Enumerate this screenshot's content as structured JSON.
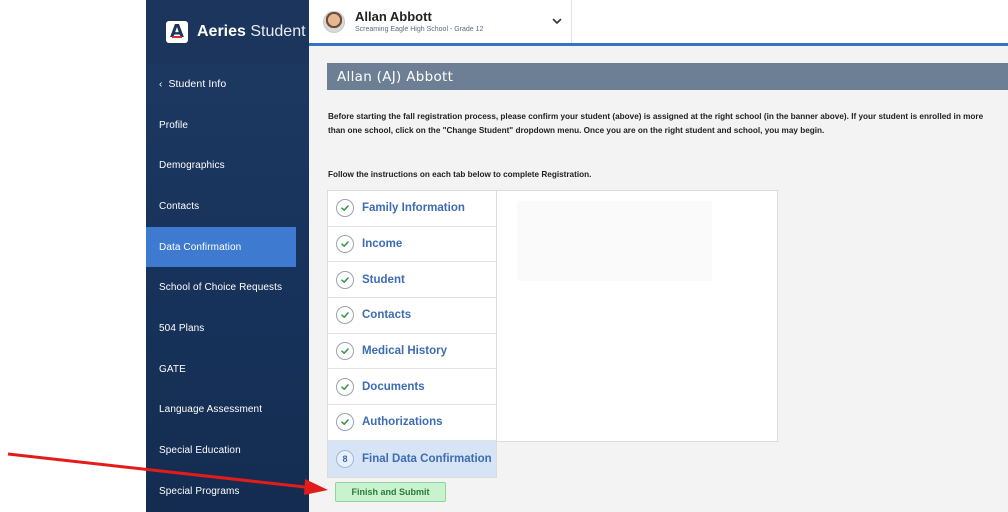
{
  "brand": {
    "bold": "Aeries",
    "light": "Student"
  },
  "student": {
    "name": "Allan Abbott",
    "school": "Screaming Eagle High School - Grade 12"
  },
  "sidebar": {
    "items": [
      {
        "label": "Student Info",
        "back": true
      },
      {
        "label": "Profile"
      },
      {
        "label": "Demographics"
      },
      {
        "label": "Contacts"
      },
      {
        "label": "Data Confirmation",
        "active": true
      },
      {
        "label": "School of Choice Requests"
      },
      {
        "label": "504 Plans"
      },
      {
        "label": "GATE"
      },
      {
        "label": "Language Assessment"
      },
      {
        "label": "Special Education"
      },
      {
        "label": "Special Programs"
      }
    ]
  },
  "main": {
    "title": "Allan (AJ) Abbott",
    "intro": "Before starting the fall registration process, please confirm your student (above) is assigned at the right school (in the banner above). If your student is enrolled in more than one school, click on the \"Change Student\" dropdown menu. Once you are on the right student and school, you may begin.",
    "follow": "Follow the instructions on each tab below to complete Registration.",
    "tabs": [
      {
        "label": "Family Information",
        "done": true
      },
      {
        "label": "Income",
        "done": true
      },
      {
        "label": "Student",
        "done": true
      },
      {
        "label": "Contacts",
        "done": true
      },
      {
        "label": "Medical History",
        "done": true
      },
      {
        "label": "Documents",
        "done": true
      },
      {
        "label": "Authorizations",
        "done": true
      },
      {
        "label": "Final Data Confirmation",
        "done": false,
        "number": "8"
      }
    ],
    "finish_label": "Finish and Submit"
  },
  "colors": {
    "sidebar": "#1b355c",
    "accent": "#3f7ad1",
    "title_bar": "#6c7f95",
    "check": "#3c9a4a",
    "annotation_arrow": "#e31b1b"
  }
}
